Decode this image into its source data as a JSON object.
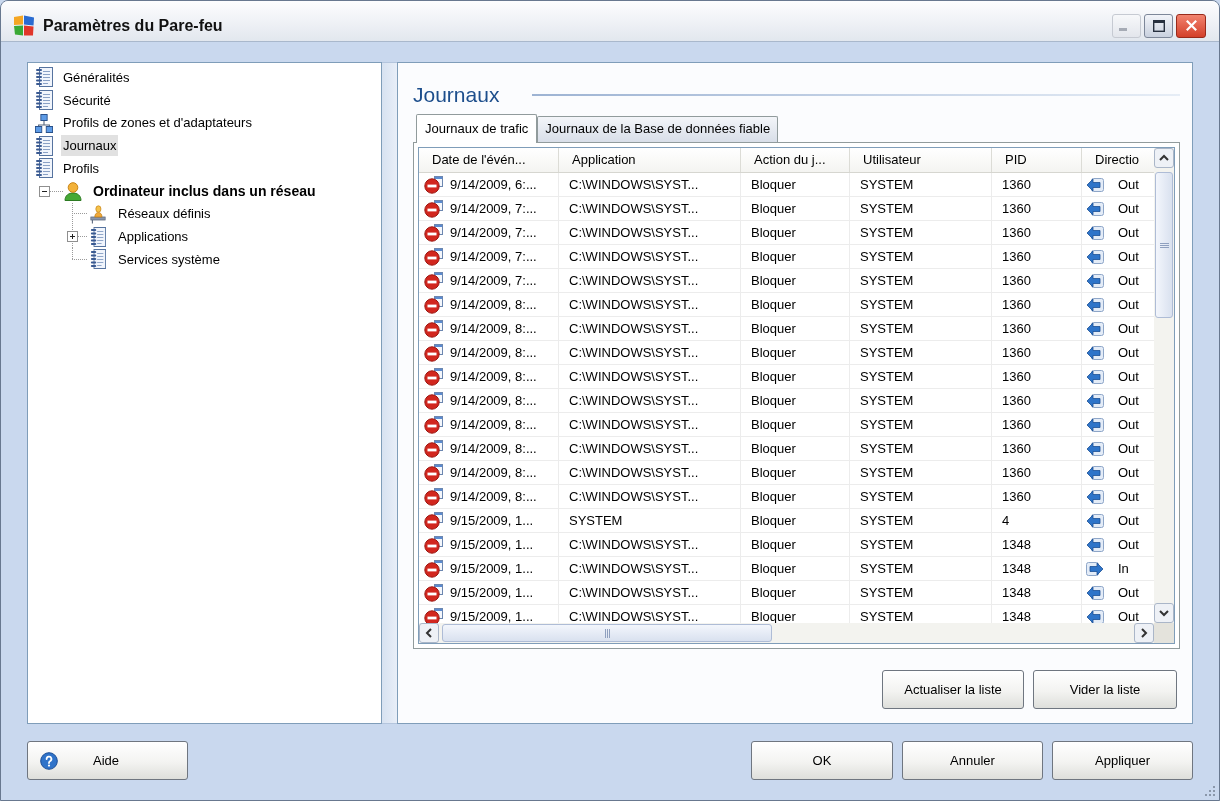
{
  "window": {
    "title": "Paramètres du Pare-feu",
    "buttons": [
      {
        "kind": "minimize",
        "disabled": true
      },
      {
        "kind": "maximize",
        "disabled": false
      },
      {
        "kind": "close",
        "disabled": false
      }
    ]
  },
  "sidebar": {
    "tree": [
      {
        "label": "Généralités",
        "kind": "log",
        "selected": false,
        "active": false
      },
      {
        "label": "Sécurité",
        "kind": "log",
        "selected": false,
        "active": false
      },
      {
        "label": "Profils de zones et d'adaptateurs",
        "kind": "network",
        "selected": false,
        "active": false
      },
      {
        "label": "Journaux",
        "kind": "log",
        "selected": true,
        "active": false
      },
      {
        "label": "Profils",
        "kind": "log",
        "selected": false,
        "active": false
      },
      {
        "label": "Ordinateur inclus dans un réseau",
        "kind": "user",
        "selected": false,
        "active": true,
        "expanded": true,
        "children": [
          {
            "label": "Réseaux définis",
            "kind": "share",
            "selected": false,
            "active": false
          },
          {
            "label": "Applications",
            "kind": "log",
            "selected": false,
            "active": false,
            "expanded": false
          },
          {
            "label": "Services système",
            "kind": "log",
            "selected": false,
            "active": false
          }
        ]
      }
    ]
  },
  "content": {
    "heading": "Journaux",
    "tabs": [
      {
        "label": "Journaux de trafic",
        "selected": true
      },
      {
        "label": "Journaux de la Base de données fiable",
        "selected": false
      }
    ],
    "table": {
      "columns": [
        "Date de l'évén...",
        "Application",
        "Action du j...",
        "Utilisateur",
        "PID",
        "Directio"
      ],
      "rows": [
        {
          "date": "9/14/2009, 6:...",
          "application": "C:\\WINDOWS\\SYST...",
          "action": "Bloquer",
          "user": "SYSTEM",
          "pid": "1360",
          "direction": {
            "kind": "out",
            "label": "Out"
          }
        },
        {
          "date": "9/14/2009, 7:...",
          "application": "C:\\WINDOWS\\SYST...",
          "action": "Bloquer",
          "user": "SYSTEM",
          "pid": "1360",
          "direction": {
            "kind": "out",
            "label": "Out"
          }
        },
        {
          "date": "9/14/2009, 7:...",
          "application": "C:\\WINDOWS\\SYST...",
          "action": "Bloquer",
          "user": "SYSTEM",
          "pid": "1360",
          "direction": {
            "kind": "out",
            "label": "Out"
          }
        },
        {
          "date": "9/14/2009, 7:...",
          "application": "C:\\WINDOWS\\SYST...",
          "action": "Bloquer",
          "user": "SYSTEM",
          "pid": "1360",
          "direction": {
            "kind": "out",
            "label": "Out"
          }
        },
        {
          "date": "9/14/2009, 7:...",
          "application": "C:\\WINDOWS\\SYST...",
          "action": "Bloquer",
          "user": "SYSTEM",
          "pid": "1360",
          "direction": {
            "kind": "out",
            "label": "Out"
          }
        },
        {
          "date": "9/14/2009, 8:...",
          "application": "C:\\WINDOWS\\SYST...",
          "action": "Bloquer",
          "user": "SYSTEM",
          "pid": "1360",
          "direction": {
            "kind": "out",
            "label": "Out"
          }
        },
        {
          "date": "9/14/2009, 8:...",
          "application": "C:\\WINDOWS\\SYST...",
          "action": "Bloquer",
          "user": "SYSTEM",
          "pid": "1360",
          "direction": {
            "kind": "out",
            "label": "Out"
          }
        },
        {
          "date": "9/14/2009, 8:...",
          "application": "C:\\WINDOWS\\SYST...",
          "action": "Bloquer",
          "user": "SYSTEM",
          "pid": "1360",
          "direction": {
            "kind": "out",
            "label": "Out"
          }
        },
        {
          "date": "9/14/2009, 8:...",
          "application": "C:\\WINDOWS\\SYST...",
          "action": "Bloquer",
          "user": "SYSTEM",
          "pid": "1360",
          "direction": {
            "kind": "out",
            "label": "Out"
          }
        },
        {
          "date": "9/14/2009, 8:...",
          "application": "C:\\WINDOWS\\SYST...",
          "action": "Bloquer",
          "user": "SYSTEM",
          "pid": "1360",
          "direction": {
            "kind": "out",
            "label": "Out"
          }
        },
        {
          "date": "9/14/2009, 8:...",
          "application": "C:\\WINDOWS\\SYST...",
          "action": "Bloquer",
          "user": "SYSTEM",
          "pid": "1360",
          "direction": {
            "kind": "out",
            "label": "Out"
          }
        },
        {
          "date": "9/14/2009, 8:...",
          "application": "C:\\WINDOWS\\SYST...",
          "action": "Bloquer",
          "user": "SYSTEM",
          "pid": "1360",
          "direction": {
            "kind": "out",
            "label": "Out"
          }
        },
        {
          "date": "9/14/2009, 8:...",
          "application": "C:\\WINDOWS\\SYST...",
          "action": "Bloquer",
          "user": "SYSTEM",
          "pid": "1360",
          "direction": {
            "kind": "out",
            "label": "Out"
          }
        },
        {
          "date": "9/14/2009, 8:...",
          "application": "C:\\WINDOWS\\SYST...",
          "action": "Bloquer",
          "user": "SYSTEM",
          "pid": "1360",
          "direction": {
            "kind": "out",
            "label": "Out"
          }
        },
        {
          "date": "9/15/2009, 1...",
          "application": "SYSTEM",
          "action": "Bloquer",
          "user": "SYSTEM",
          "pid": "4",
          "direction": {
            "kind": "out",
            "label": "Out"
          }
        },
        {
          "date": "9/15/2009, 1...",
          "application": "C:\\WINDOWS\\SYST...",
          "action": "Bloquer",
          "user": "SYSTEM",
          "pid": "1348",
          "direction": {
            "kind": "out",
            "label": "Out"
          }
        },
        {
          "date": "9/15/2009, 1...",
          "application": "C:\\WINDOWS\\SYST...",
          "action": "Bloquer",
          "user": "SYSTEM",
          "pid": "1348",
          "direction": {
            "kind": "in",
            "label": "In"
          }
        },
        {
          "date": "9/15/2009, 1...",
          "application": "C:\\WINDOWS\\SYST...",
          "action": "Bloquer",
          "user": "SYSTEM",
          "pid": "1348",
          "direction": {
            "kind": "out",
            "label": "Out"
          }
        },
        {
          "date": "9/15/2009, 1...",
          "application": "C:\\WINDOWS\\SYST...",
          "action": "Bloquer",
          "user": "SYSTEM",
          "pid": "1348",
          "direction": {
            "kind": "out",
            "label": "Out"
          }
        }
      ]
    },
    "buttons": [
      "Actualiser la liste",
      "Vider la liste"
    ]
  },
  "footer": {
    "help_button": "Aide",
    "buttons": [
      "OK",
      "Annuler",
      "Appliquer"
    ]
  }
}
